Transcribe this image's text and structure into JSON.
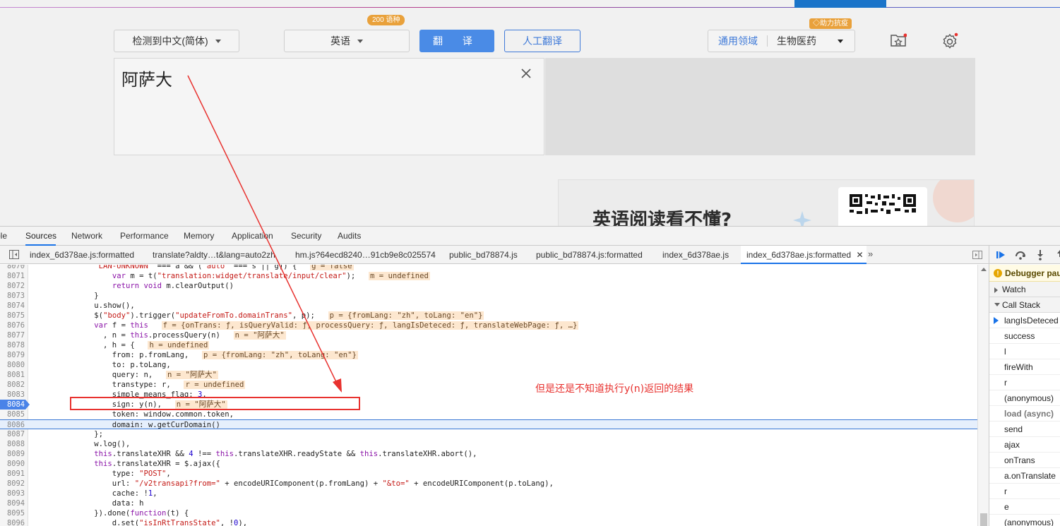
{
  "translator": {
    "source_lang": "检测到中文(简体)",
    "target_lang": "英语",
    "lang_badge": "200 语种",
    "translate_button": "翻 译",
    "human_translate_button": "人工翻译",
    "domain_label": "通用领域",
    "domain_value": "生物医药",
    "epidemic_badge": "助力抗疫",
    "input_text": "阿萨大",
    "ad_text": "英语阅读看不懂?"
  },
  "devtools": {
    "tabs": [
      "ole",
      "Sources",
      "Network",
      "Performance",
      "Memory",
      "Application",
      "Security",
      "Audits"
    ],
    "active_tab": "Sources",
    "file_tabs": [
      "index_6d378ae.js:formatted",
      "translate?aldty…t&lang=auto2zh",
      "hm.js?64ecd8240…91cb9e8c025574",
      "public_bd78874.js",
      "public_bd78874.js:formatted",
      "index_6d378ae.js",
      "index_6d378ae.js:formatted"
    ],
    "code_lines": [
      {
        "n": "8070",
        "html": "              <span class=\"str\">\"LAN-UNKNOWN\"</span> === a &amp;&amp; (<span class=\"str\">\"auto\"</span> === s || g)) {  <span class=\"ev\">g = false</span>"
      },
      {
        "n": "8071",
        "html": "                  <span class=\"kw\">var</span> m = t(<span class=\"str\">\"translation:widget/translate/input/clear\"</span>);  <span class=\"ev\">m = undefined</span>"
      },
      {
        "n": "8072",
        "html": "                  <span class=\"kw\">return void</span> m.clearOutput()"
      },
      {
        "n": "8073",
        "html": "              }"
      },
      {
        "n": "8074",
        "html": "              u.show(),"
      },
      {
        "n": "8075",
        "html": "              $(<span class=\"str\">\"body\"</span>).trigger(<span class=\"str\">\"updateFromTo.domainTrans\"</span>, p);  <span class=\"ev\">p = {fromLang: \"zh\", toLang: \"en\"}</span>"
      },
      {
        "n": "8076",
        "html": "              <span class=\"kw\">var</span> f = <span class=\"kw\">this</span>  <span class=\"ev\">f = {onTrans: ƒ, isQueryValid: ƒ, processQuery: ƒ, langIsDeteced: ƒ, translateWebPage: ƒ, …}</span>"
      },
      {
        "n": "8077",
        "html": "                , n = <span class=\"kw\">this</span>.processQuery(n)  <span class=\"ev\">n = \"阿萨大\"</span>"
      },
      {
        "n": "8078",
        "html": "                , h = {  <span class=\"ev\">h = undefined</span>"
      },
      {
        "n": "8079",
        "html": "                  from: p.fromLang,  <span class=\"ev\">p = {fromLang: \"zh\", toLang: \"en\"}</span>"
      },
      {
        "n": "8080",
        "html": "                  to: p.toLang,"
      },
      {
        "n": "8081",
        "html": "                  query: n,  <span class=\"ev\">n = \"阿萨大\"</span>"
      },
      {
        "n": "8082",
        "html": "                  transtype: r,  <span class=\"ev\">r = undefined</span>"
      },
      {
        "n": "8083",
        "html": "                  simple_means_flag: <span class=\"num\">3</span>,"
      },
      {
        "n": "8084",
        "html": "                  sign: y(n),  <span class=\"ev\">n = \"阿萨大\"</span>",
        "bp": true
      },
      {
        "n": "8085",
        "html": "                  token: window.common.token,"
      },
      {
        "n": "8086",
        "html": "                  domain: w.getCurDomain()",
        "exec": true
      },
      {
        "n": "8087",
        "html": "              };"
      },
      {
        "n": "8088",
        "html": "              w.log(),"
      },
      {
        "n": "8089",
        "html": "              <span class=\"kw\">this</span>.translateXHR &amp;&amp; <span class=\"num\">4</span> !== <span class=\"kw\">this</span>.translateXHR.readyState &amp;&amp; <span class=\"kw\">this</span>.translateXHR.abort(),"
      },
      {
        "n": "8090",
        "html": "              <span class=\"kw\">this</span>.translateXHR = $.ajax({"
      },
      {
        "n": "8091",
        "html": "                  type: <span class=\"str\">\"POST\"</span>,"
      },
      {
        "n": "8092",
        "html": "                  url: <span class=\"str\">\"/v2transapi?from=\"</span> + encodeURIComponent(p.fromLang) + <span class=\"str\">\"&amp;to=\"</span> + encodeURIComponent(p.toLang),"
      },
      {
        "n": "8093",
        "html": "                  cache: !<span class=\"num\">1</span>,"
      },
      {
        "n": "8094",
        "html": "                  data: h"
      },
      {
        "n": "8095",
        "html": "              }).done(<span class=\"kw\">function</span>(t) {"
      },
      {
        "n": "8096",
        "html": "                  d.set(<span class=\"str\">\"isInRtTransState\"</span>, !<span class=\"num\">0</span>),"
      }
    ],
    "debugger": {
      "paused_label": "Debugger paused",
      "watch_label": "Watch",
      "call_stack_label": "Call Stack",
      "frames": [
        {
          "name": "langIsDeteced",
          "current": true
        },
        {
          "name": "success"
        },
        {
          "name": "l"
        },
        {
          "name": "fireWith"
        },
        {
          "name": "r"
        },
        {
          "name": "(anonymous)"
        },
        {
          "name": "load (async)",
          "async": true
        },
        {
          "name": "send"
        },
        {
          "name": "ajax"
        },
        {
          "name": "onTrans"
        },
        {
          "name": "a.onTranslate"
        },
        {
          "name": "r"
        },
        {
          "name": "e"
        },
        {
          "name": "(anonymous)"
        }
      ]
    }
  },
  "annotation": {
    "note": "但是还是不知道执行y(n)返回的结果",
    "color": "#e8322f"
  }
}
